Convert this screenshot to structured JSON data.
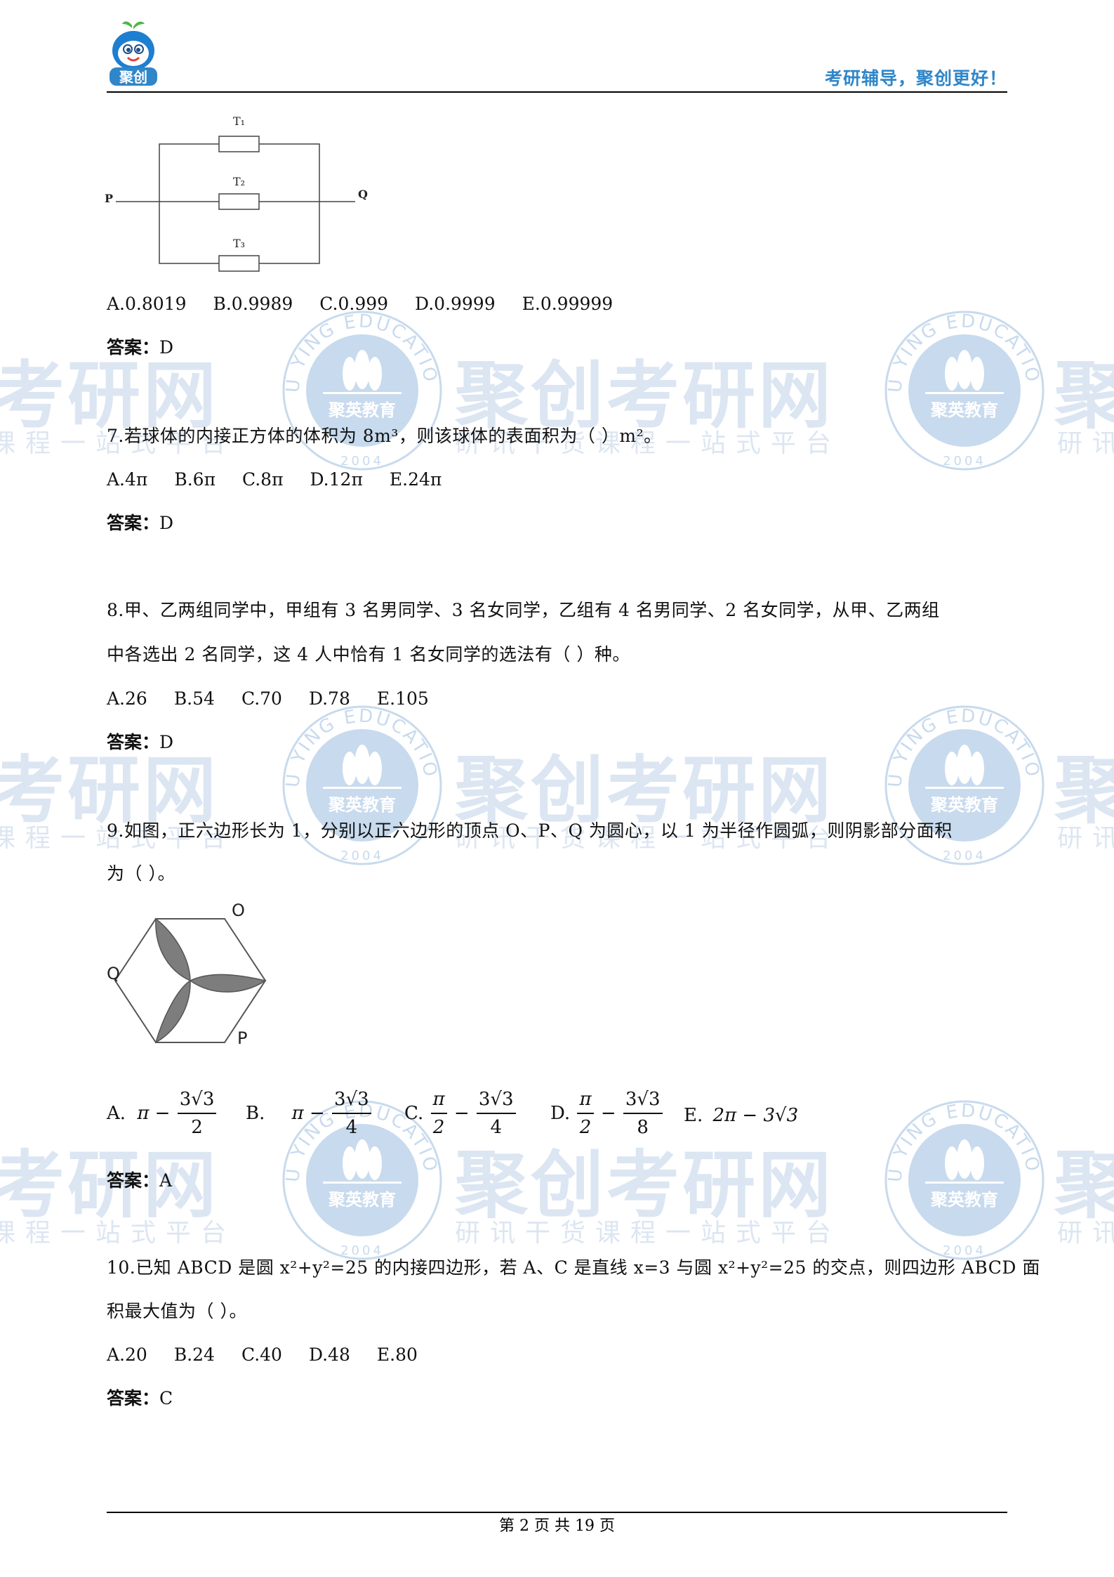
{
  "header": {
    "logo_text": "聚创",
    "slogan": "考研辅导，聚创更好！"
  },
  "watermark": {
    "main": "聚创考研网",
    "main_left": "考研网",
    "main_right": "聚",
    "sub": "研讯干货课程一站式平台",
    "sub_left": "课程一站式平台",
    "sub_right": "研讯",
    "seal_top": "JU YING EDUCATION",
    "seal_center": "聚英教育",
    "seal_year": "2004"
  },
  "diagram1": {
    "labels": [
      "T₁",
      "T₂",
      "T₃",
      "P",
      "Q"
    ]
  },
  "q6": {
    "options": [
      "A.0.8019",
      "B.0.9989",
      "C.0.999",
      "D.0.9999",
      "E.0.99999"
    ],
    "answer_label": "答案：",
    "answer": "D"
  },
  "q7": {
    "question": "7.若球体的内接正方体的体积为 8m³，则该球体的表面积为（  ）m²。",
    "options": [
      "A.4π",
      "B.6π",
      "C.8π",
      "D.12π",
      "E.24π"
    ],
    "answer_label": "答案：",
    "answer": "D"
  },
  "q8": {
    "question_line1": "8.甲、乙两组同学中，甲组有 3 名男同学、3 名女同学，乙组有 4 名男同学、2 名女同学，从甲、乙两组",
    "question_line2": "中各选出 2 名同学，这 4 人中恰有 1 名女同学的选法有（ ）种。",
    "options": [
      "A.26",
      "B.54",
      "C.70",
      "D.78",
      "E.105"
    ],
    "answer_label": "答案：",
    "answer": "D"
  },
  "q9": {
    "question_line1": "9.如图，正六边形长为 1，分别以正六边形的顶点 O、P、Q 为圆心，以 1 为半径作圆弧，则阴影部分面积",
    "question_line2": "为（ ）。",
    "figure_labels": [
      "O",
      "Q",
      "P"
    ],
    "options": {
      "a_label": "A.",
      "a_lead": "π −",
      "a_num": "3√3",
      "a_den": "2",
      "b_label": "B.",
      "b_lead": "π −",
      "b_num": "3√3",
      "b_den": "4",
      "c_label": "C.",
      "c_num1": "π",
      "c_den1": "2",
      "c_num2": "3√3",
      "c_den2": "4",
      "d_label": "D.",
      "d_num1": "π",
      "d_den1": "2",
      "d_num2": "3√3",
      "d_den2": "8",
      "e_label": "E.",
      "e_expr": "2π − 3√3"
    },
    "answer_label": "答案：",
    "answer": "A"
  },
  "q10": {
    "question_line1": "10.已知 ABCD 是圆 x²+y²=25 的内接四边形，若 A、C 是直线 x=3 与圆 x²+y²=25 的交点，则四边形 ABCD 面",
    "question_line2": "积最大值为（ ）。",
    "options": [
      "A.20",
      "B.24",
      "C.40",
      "D.48",
      "E.80"
    ],
    "answer_label": "答案：",
    "answer": "C"
  },
  "footer": {
    "page_text": "第 2 页 共 19 页"
  },
  "colors": {
    "brand_blue": "#2f86c8",
    "watermark": "#96b4d7",
    "shade": "#808080"
  }
}
